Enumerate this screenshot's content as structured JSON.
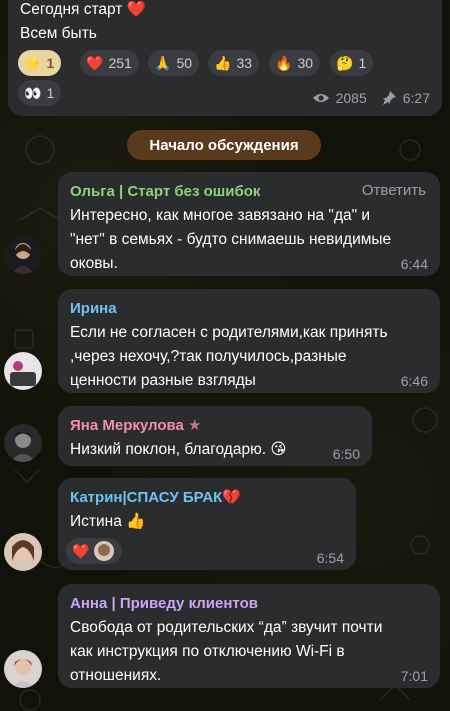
{
  "channel_post": {
    "line1": "Сегодня старт",
    "line1_emoji": "❤️",
    "line2": "Всем быть",
    "reactions": [
      {
        "emoji": "⭐",
        "count": "1",
        "active": true
      },
      {
        "emoji": "❤️",
        "count": "251"
      },
      {
        "emoji": "🙏",
        "count": "50"
      },
      {
        "emoji": "👍",
        "count": "33"
      },
      {
        "emoji": "🔥",
        "count": "30"
      },
      {
        "emoji": "🤔",
        "count": "1"
      },
      {
        "emoji": "👀",
        "count": "1"
      }
    ],
    "views": "2085",
    "time": "6:27"
  },
  "discussion_label": "Начало обсуждения",
  "comments": [
    {
      "name": "Ольга | Старт без ошибок",
      "name_color": "#8fd17c",
      "reply_label": "Ответить",
      "text_lines": [
        "Интересно, как многое завязано на \"да\" и",
        "\"нет\" в семьях - будто снимаешь невидимые",
        "оковы."
      ],
      "time": "6:44"
    },
    {
      "name": "Ирина",
      "name_color": "#6ec4f0",
      "text_lines": [
        "Если не согласен с родителями,как принять",
        ",через нехочу,?так получилось,разные",
        "ценности разные взгляды"
      ],
      "time": "6:46"
    },
    {
      "name": "Яна Меркулова",
      "name_color": "#f28fb0",
      "name_icon": "★",
      "text_lines": [
        "Низкий поклон, благодарю. 😘"
      ],
      "time": "6:50"
    },
    {
      "name": "Катрин|СПАСУ БРАК",
      "name_emoji": "💔",
      "name_color": "#6ec4f0",
      "text_lines": [
        "Истина 👍"
      ],
      "reaction_emoji": "❤️",
      "time": "6:54"
    },
    {
      "name": "Анна | Приведу клиентов",
      "name_color": "#c6a6f5",
      "text_lines": [
        "Свобода от родительских “да” звучит почти",
        "как инструкция по отключению Wi-Fi в",
        "отношениях."
      ],
      "time": "7:01"
    }
  ],
  "colors": {
    "bubble": "#2b2c2e",
    "time": "#9aa0a6",
    "discussion_pill": "#5a3a1c"
  }
}
